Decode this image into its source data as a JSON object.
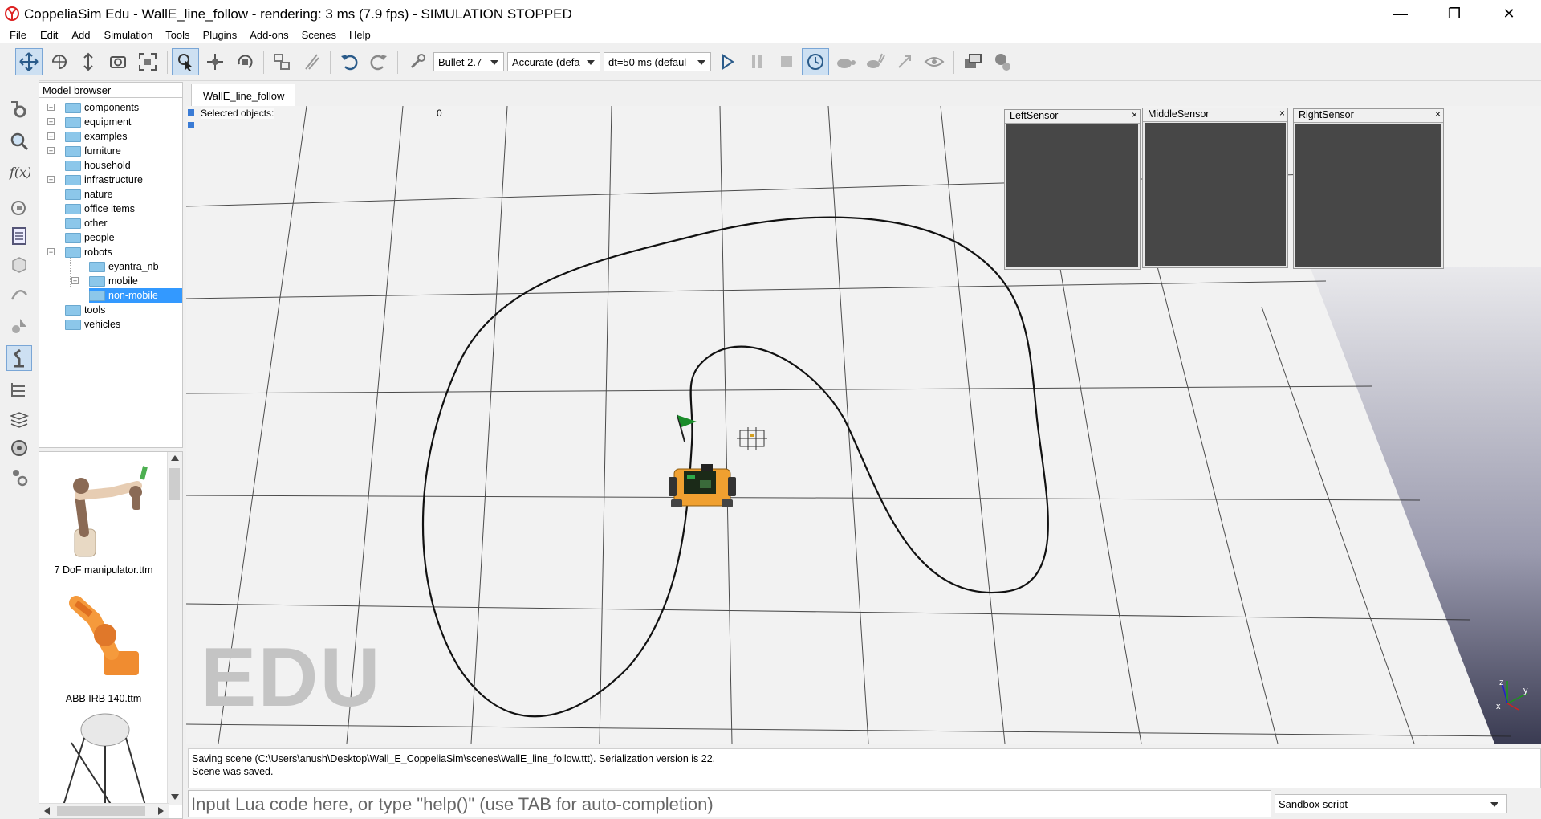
{
  "window": {
    "title": "CoppeliaSim Edu - WallE_line_follow - rendering: 3 ms (7.9 fps) - SIMULATION STOPPED",
    "controls": [
      "—",
      "❐",
      "✕"
    ]
  },
  "menu": [
    "File",
    "Edit",
    "Add",
    "Simulation",
    "Tools",
    "Plugins",
    "Add-ons",
    "Scenes",
    "Help"
  ],
  "toolbar": {
    "engine": "Bullet 2.7",
    "accuracy": "Accurate (defa",
    "timestep": "dt=50 ms (defaul"
  },
  "model_browser": {
    "header": "Model browser",
    "tree": [
      {
        "label": "components",
        "expandable": true
      },
      {
        "label": "equipment",
        "expandable": true
      },
      {
        "label": "examples",
        "expandable": true
      },
      {
        "label": "furniture",
        "expandable": true
      },
      {
        "label": "household",
        "expandable": false
      },
      {
        "label": "infrastructure",
        "expandable": true
      },
      {
        "label": "nature",
        "expandable": false
      },
      {
        "label": "office items",
        "expandable": false
      },
      {
        "label": "other",
        "expandable": false
      },
      {
        "label": "people",
        "expandable": false
      },
      {
        "label": "robots",
        "expandable": true,
        "expanded": true
      },
      {
        "label": "eyantra_nb",
        "child": true
      },
      {
        "label": "mobile",
        "child": true,
        "expandable": true
      },
      {
        "label": "non-mobile",
        "child": true,
        "selected": true
      },
      {
        "label": "tools",
        "expandable": false
      },
      {
        "label": "vehicles",
        "expandable": false
      }
    ],
    "thumbnails": [
      "7 DoF manipulator.ttm",
      "ABB IRB 140.ttm"
    ]
  },
  "scene": {
    "tab": "WallE_line_follow",
    "selected_objects_label": "Selected objects:",
    "selected_objects_count": "0",
    "watermark": "EDU",
    "sensors": [
      "LeftSensor",
      "MiddleSensor",
      "RightSensor"
    ],
    "axes": {
      "x": "x",
      "y": "y",
      "z": "z"
    }
  },
  "console": {
    "lines": [
      "Saving scene (C:\\Users\\anush\\Desktop\\Wall_E_CoppeliaSim\\scenes\\WallE_line_follow.ttt). Serialization version is 22.",
      "Scene was saved."
    ],
    "input_placeholder": "Input Lua code here, or type \"help()\" (use TAB for auto-completion)",
    "script_target": "Sandbox script"
  },
  "colors": {
    "selection": "#3399ff",
    "folder": "#8cc7ea",
    "sensor_view": "#474747",
    "robot_body": "#f0a030",
    "flag": "#1a8c2a"
  }
}
